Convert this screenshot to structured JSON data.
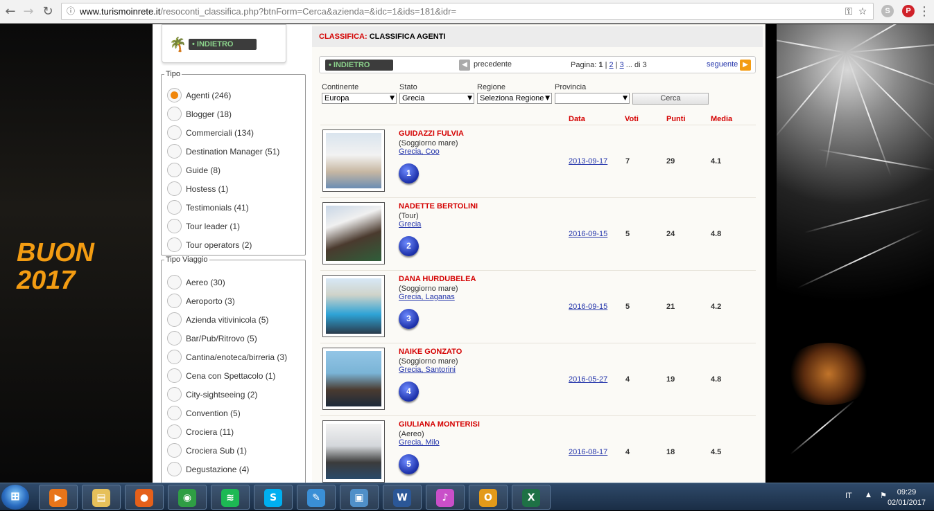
{
  "browser": {
    "url_domain": "www.turismoinrete.it",
    "url_path": "/resoconti_classifica.php?btnForm=Cerca&azienda=&idc=1&ids=181&idr="
  },
  "banner": {
    "line1": "BUON",
    "line2": "2017"
  },
  "back_label": "INDIETRO",
  "tipo": {
    "legend": "Tipo",
    "items": [
      {
        "label": "Agenti (246)",
        "selected": true
      },
      {
        "label": "Blogger (18)"
      },
      {
        "label": "Commerciali (134)"
      },
      {
        "label": "Destination Manager (51)"
      },
      {
        "label": "Guide (8)"
      },
      {
        "label": "Hostess (1)"
      },
      {
        "label": "Testimonials (41)"
      },
      {
        "label": "Tour leader (1)"
      },
      {
        "label": "Tour operators (2)"
      }
    ]
  },
  "tipo_viaggio": {
    "legend": "Tipo Viaggio",
    "items": [
      {
        "label": "Aereo (30)"
      },
      {
        "label": "Aeroporto (3)"
      },
      {
        "label": "Azienda vitivinicola (5)"
      },
      {
        "label": "Bar/Pub/Ritrovo (5)"
      },
      {
        "label": "Cantina/enoteca/birreria (3)"
      },
      {
        "label": "Cena con Spettacolo (1)"
      },
      {
        "label": "City-sightseeing (2)"
      },
      {
        "label": "Convention (5)"
      },
      {
        "label": "Crociera (11)"
      },
      {
        "label": "Crociera Sub (1)"
      },
      {
        "label": "Degustazione (4)"
      }
    ]
  },
  "header": {
    "red": "CLASSIFICA:",
    "black": "CLASSIFICA AGENTI"
  },
  "pager": {
    "prev": "precedente",
    "next": "seguente",
    "label": "Pagina:",
    "current": "1",
    "sep1": "|",
    "p2": "2",
    "sep2": "|",
    "p3": "3",
    "total": "... di 3"
  },
  "filters": {
    "continente": {
      "label": "Continente",
      "value": "Europa"
    },
    "stato": {
      "label": "Stato",
      "value": "Grecia"
    },
    "regione": {
      "label": "Regione",
      "value": "Seleziona Regione"
    },
    "provincia": {
      "label": "Provincia",
      "value": ""
    },
    "search": "Cerca"
  },
  "columns": {
    "data": "Data",
    "voti": "Voti",
    "punti": "Punti",
    "media": "Media"
  },
  "rows": [
    {
      "name": "GUIDAZZI FULVIA",
      "type": "(Soggiorno mare)",
      "place": "Grecia, Coo",
      "rank": "1",
      "date": "2013-09-17",
      "voti": "7",
      "punti": "29",
      "media": "4.1"
    },
    {
      "name": "NADETTE BERTOLINI",
      "type": "(Tour)",
      "place": "Grecia",
      "rank": "2",
      "date": "2016-09-15",
      "voti": "5",
      "punti": "24",
      "media": "4.8"
    },
    {
      "name": "DANA HURDUBELEA",
      "type": "(Soggiorno mare)",
      "place": "Grecia, Laganas",
      "rank": "3",
      "date": "2016-09-15",
      "voti": "5",
      "punti": "21",
      "media": "4.2"
    },
    {
      "name": "NAIKE GONZATO",
      "type": "(Soggiorno mare)",
      "place": "Grecia, Santorini",
      "rank": "4",
      "date": "2016-05-27",
      "voti": "4",
      "punti": "19",
      "media": "4.8"
    },
    {
      "name": "GIULIANA MONTERISI",
      "type": "(Aereo)",
      "place": "Grecia, Milo",
      "rank": "5",
      "date": "2016-08-17",
      "voti": "4",
      "punti": "18",
      "media": "4.5"
    }
  ],
  "taskbar": {
    "lang": "IT",
    "time": "09:29",
    "date": "02/01/2017",
    "apps": [
      {
        "icon": "media-player-icon",
        "color": "#e8751a",
        "glyph": "▶"
      },
      {
        "icon": "file-explorer-icon",
        "color": "#e6c05a",
        "glyph": "▤"
      },
      {
        "icon": "firefox-icon",
        "color": "#e5601a",
        "glyph": "●"
      },
      {
        "icon": "chrome-icon",
        "color": "#2f9e44",
        "glyph": "◉"
      },
      {
        "icon": "spotify-icon",
        "color": "#1db954",
        "glyph": "≋"
      },
      {
        "icon": "skype-icon",
        "color": "#00aff0",
        "glyph": "S"
      },
      {
        "icon": "live-writer-icon",
        "color": "#3a8fd6",
        "glyph": "✎"
      },
      {
        "icon": "photo-gallery-icon",
        "color": "#4f8fc8",
        "glyph": "▣"
      },
      {
        "icon": "word-icon",
        "color": "#2b5797",
        "glyph": "W"
      },
      {
        "icon": "itunes-icon",
        "color": "#c94fc9",
        "glyph": "♪"
      },
      {
        "icon": "outlook-icon",
        "color": "#e39a1a",
        "glyph": "O"
      },
      {
        "icon": "excel-icon",
        "color": "#1e7145",
        "glyph": "X"
      }
    ]
  }
}
